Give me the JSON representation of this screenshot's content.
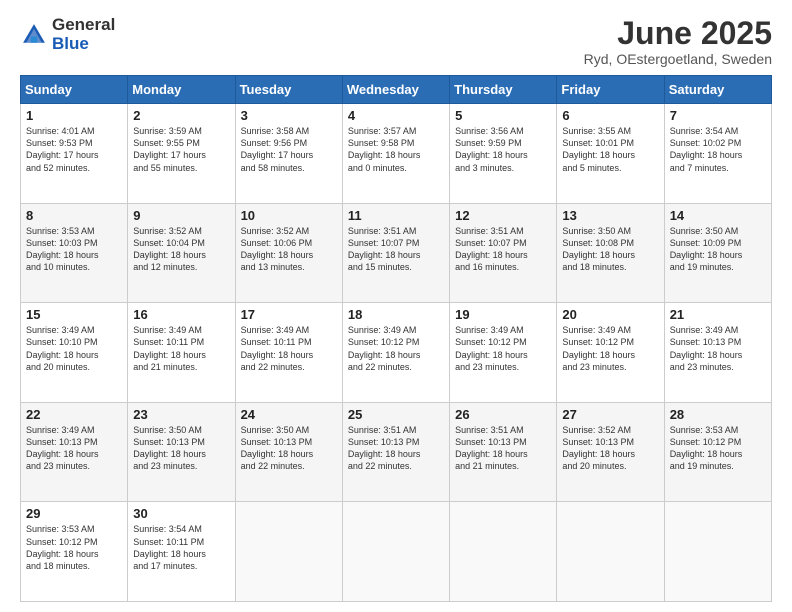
{
  "logo": {
    "general": "General",
    "blue": "Blue"
  },
  "header": {
    "title": "June 2025",
    "subtitle": "Ryd, OEstergoetland, Sweden"
  },
  "days_of_week": [
    "Sunday",
    "Monday",
    "Tuesday",
    "Wednesday",
    "Thursday",
    "Friday",
    "Saturday"
  ],
  "weeks": [
    [
      {
        "day": "1",
        "info": "Sunrise: 4:01 AM\nSunset: 9:53 PM\nDaylight: 17 hours\nand 52 minutes."
      },
      {
        "day": "2",
        "info": "Sunrise: 3:59 AM\nSunset: 9:55 PM\nDaylight: 17 hours\nand 55 minutes."
      },
      {
        "day": "3",
        "info": "Sunrise: 3:58 AM\nSunset: 9:56 PM\nDaylight: 17 hours\nand 58 minutes."
      },
      {
        "day": "4",
        "info": "Sunrise: 3:57 AM\nSunset: 9:58 PM\nDaylight: 18 hours\nand 0 minutes."
      },
      {
        "day": "5",
        "info": "Sunrise: 3:56 AM\nSunset: 9:59 PM\nDaylight: 18 hours\nand 3 minutes."
      },
      {
        "day": "6",
        "info": "Sunrise: 3:55 AM\nSunset: 10:01 PM\nDaylight: 18 hours\nand 5 minutes."
      },
      {
        "day": "7",
        "info": "Sunrise: 3:54 AM\nSunset: 10:02 PM\nDaylight: 18 hours\nand 7 minutes."
      }
    ],
    [
      {
        "day": "8",
        "info": "Sunrise: 3:53 AM\nSunset: 10:03 PM\nDaylight: 18 hours\nand 10 minutes."
      },
      {
        "day": "9",
        "info": "Sunrise: 3:52 AM\nSunset: 10:04 PM\nDaylight: 18 hours\nand 12 minutes."
      },
      {
        "day": "10",
        "info": "Sunrise: 3:52 AM\nSunset: 10:06 PM\nDaylight: 18 hours\nand 13 minutes."
      },
      {
        "day": "11",
        "info": "Sunrise: 3:51 AM\nSunset: 10:07 PM\nDaylight: 18 hours\nand 15 minutes."
      },
      {
        "day": "12",
        "info": "Sunrise: 3:51 AM\nSunset: 10:07 PM\nDaylight: 18 hours\nand 16 minutes."
      },
      {
        "day": "13",
        "info": "Sunrise: 3:50 AM\nSunset: 10:08 PM\nDaylight: 18 hours\nand 18 minutes."
      },
      {
        "day": "14",
        "info": "Sunrise: 3:50 AM\nSunset: 10:09 PM\nDaylight: 18 hours\nand 19 minutes."
      }
    ],
    [
      {
        "day": "15",
        "info": "Sunrise: 3:49 AM\nSunset: 10:10 PM\nDaylight: 18 hours\nand 20 minutes."
      },
      {
        "day": "16",
        "info": "Sunrise: 3:49 AM\nSunset: 10:11 PM\nDaylight: 18 hours\nand 21 minutes."
      },
      {
        "day": "17",
        "info": "Sunrise: 3:49 AM\nSunset: 10:11 PM\nDaylight: 18 hours\nand 22 minutes."
      },
      {
        "day": "18",
        "info": "Sunrise: 3:49 AM\nSunset: 10:12 PM\nDaylight: 18 hours\nand 22 minutes."
      },
      {
        "day": "19",
        "info": "Sunrise: 3:49 AM\nSunset: 10:12 PM\nDaylight: 18 hours\nand 23 minutes."
      },
      {
        "day": "20",
        "info": "Sunrise: 3:49 AM\nSunset: 10:12 PM\nDaylight: 18 hours\nand 23 minutes."
      },
      {
        "day": "21",
        "info": "Sunrise: 3:49 AM\nSunset: 10:13 PM\nDaylight: 18 hours\nand 23 minutes."
      }
    ],
    [
      {
        "day": "22",
        "info": "Sunrise: 3:49 AM\nSunset: 10:13 PM\nDaylight: 18 hours\nand 23 minutes."
      },
      {
        "day": "23",
        "info": "Sunrise: 3:50 AM\nSunset: 10:13 PM\nDaylight: 18 hours\nand 23 minutes."
      },
      {
        "day": "24",
        "info": "Sunrise: 3:50 AM\nSunset: 10:13 PM\nDaylight: 18 hours\nand 22 minutes."
      },
      {
        "day": "25",
        "info": "Sunrise: 3:51 AM\nSunset: 10:13 PM\nDaylight: 18 hours\nand 22 minutes."
      },
      {
        "day": "26",
        "info": "Sunrise: 3:51 AM\nSunset: 10:13 PM\nDaylight: 18 hours\nand 21 minutes."
      },
      {
        "day": "27",
        "info": "Sunrise: 3:52 AM\nSunset: 10:13 PM\nDaylight: 18 hours\nand 20 minutes."
      },
      {
        "day": "28",
        "info": "Sunrise: 3:53 AM\nSunset: 10:12 PM\nDaylight: 18 hours\nand 19 minutes."
      }
    ],
    [
      {
        "day": "29",
        "info": "Sunrise: 3:53 AM\nSunset: 10:12 PM\nDaylight: 18 hours\nand 18 minutes."
      },
      {
        "day": "30",
        "info": "Sunrise: 3:54 AM\nSunset: 10:11 PM\nDaylight: 18 hours\nand 17 minutes."
      },
      {
        "day": "",
        "info": ""
      },
      {
        "day": "",
        "info": ""
      },
      {
        "day": "",
        "info": ""
      },
      {
        "day": "",
        "info": ""
      },
      {
        "day": "",
        "info": ""
      }
    ]
  ]
}
